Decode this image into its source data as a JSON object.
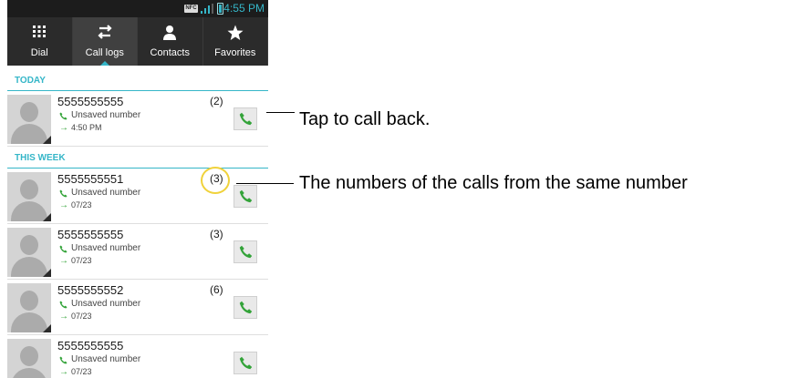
{
  "status_bar": {
    "nfc": "NFC",
    "time": "4:55 PM"
  },
  "tabs": [
    {
      "label": "Dial",
      "icon": "dialpad-icon",
      "active": false
    },
    {
      "label": "Call logs",
      "icon": "call-logs-icon",
      "active": true
    },
    {
      "label": "Contacts",
      "icon": "contact-person-icon",
      "active": false
    },
    {
      "label": "Favorites",
      "icon": "star-icon",
      "active": false
    }
  ],
  "sections": {
    "today": "TODAY",
    "this_week": "THIS WEEK"
  },
  "calls": [
    {
      "number": "5555555555",
      "type": "Unsaved number",
      "time": "4:50 PM",
      "count": "(2)"
    },
    {
      "number": "5555555551",
      "type": "Unsaved number",
      "time": "07/23",
      "count": "(3)"
    },
    {
      "number": "5555555555",
      "type": "Unsaved number",
      "time": "07/23",
      "count": "(3)"
    },
    {
      "number": "5555555552",
      "type": "Unsaved number",
      "time": "07/23",
      "count": "(6)"
    },
    {
      "number": "5555555555",
      "type": "Unsaved number",
      "time": "07/23",
      "count": ""
    }
  ],
  "annotations": {
    "tap_to_call_back": "Tap to call back.",
    "call_count_note": "The numbers of the calls from the same number"
  },
  "colors": {
    "accent": "#35b6c8",
    "call_green": "#33a339",
    "highlight": "#f0d23b",
    "tab_bar": "#2b2b2b"
  }
}
